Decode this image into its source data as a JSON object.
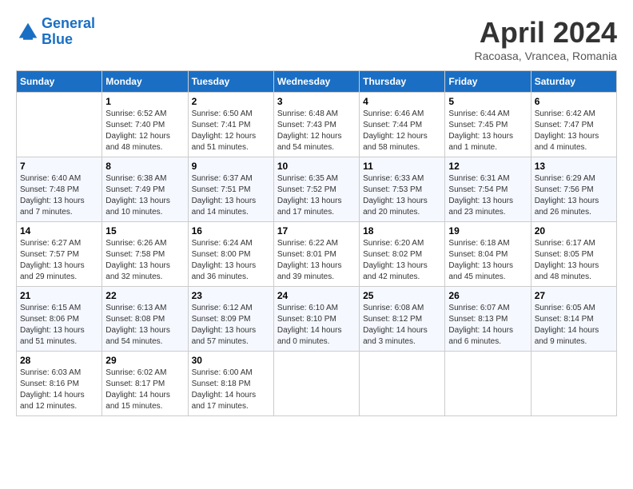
{
  "header": {
    "logo_line1": "General",
    "logo_line2": "Blue",
    "title": "April 2024",
    "subtitle": "Racoasa, Vrancea, Romania"
  },
  "calendar": {
    "headers": [
      "Sunday",
      "Monday",
      "Tuesday",
      "Wednesday",
      "Thursday",
      "Friday",
      "Saturday"
    ],
    "weeks": [
      [
        {
          "day": "",
          "info": ""
        },
        {
          "day": "1",
          "info": "Sunrise: 6:52 AM\nSunset: 7:40 PM\nDaylight: 12 hours\nand 48 minutes."
        },
        {
          "day": "2",
          "info": "Sunrise: 6:50 AM\nSunset: 7:41 PM\nDaylight: 12 hours\nand 51 minutes."
        },
        {
          "day": "3",
          "info": "Sunrise: 6:48 AM\nSunset: 7:43 PM\nDaylight: 12 hours\nand 54 minutes."
        },
        {
          "day": "4",
          "info": "Sunrise: 6:46 AM\nSunset: 7:44 PM\nDaylight: 12 hours\nand 58 minutes."
        },
        {
          "day": "5",
          "info": "Sunrise: 6:44 AM\nSunset: 7:45 PM\nDaylight: 13 hours\nand 1 minute."
        },
        {
          "day": "6",
          "info": "Sunrise: 6:42 AM\nSunset: 7:47 PM\nDaylight: 13 hours\nand 4 minutes."
        }
      ],
      [
        {
          "day": "7",
          "info": "Sunrise: 6:40 AM\nSunset: 7:48 PM\nDaylight: 13 hours\nand 7 minutes."
        },
        {
          "day": "8",
          "info": "Sunrise: 6:38 AM\nSunset: 7:49 PM\nDaylight: 13 hours\nand 10 minutes."
        },
        {
          "day": "9",
          "info": "Sunrise: 6:37 AM\nSunset: 7:51 PM\nDaylight: 13 hours\nand 14 minutes."
        },
        {
          "day": "10",
          "info": "Sunrise: 6:35 AM\nSunset: 7:52 PM\nDaylight: 13 hours\nand 17 minutes."
        },
        {
          "day": "11",
          "info": "Sunrise: 6:33 AM\nSunset: 7:53 PM\nDaylight: 13 hours\nand 20 minutes."
        },
        {
          "day": "12",
          "info": "Sunrise: 6:31 AM\nSunset: 7:54 PM\nDaylight: 13 hours\nand 23 minutes."
        },
        {
          "day": "13",
          "info": "Sunrise: 6:29 AM\nSunset: 7:56 PM\nDaylight: 13 hours\nand 26 minutes."
        }
      ],
      [
        {
          "day": "14",
          "info": "Sunrise: 6:27 AM\nSunset: 7:57 PM\nDaylight: 13 hours\nand 29 minutes."
        },
        {
          "day": "15",
          "info": "Sunrise: 6:26 AM\nSunset: 7:58 PM\nDaylight: 13 hours\nand 32 minutes."
        },
        {
          "day": "16",
          "info": "Sunrise: 6:24 AM\nSunset: 8:00 PM\nDaylight: 13 hours\nand 36 minutes."
        },
        {
          "day": "17",
          "info": "Sunrise: 6:22 AM\nSunset: 8:01 PM\nDaylight: 13 hours\nand 39 minutes."
        },
        {
          "day": "18",
          "info": "Sunrise: 6:20 AM\nSunset: 8:02 PM\nDaylight: 13 hours\nand 42 minutes."
        },
        {
          "day": "19",
          "info": "Sunrise: 6:18 AM\nSunset: 8:04 PM\nDaylight: 13 hours\nand 45 minutes."
        },
        {
          "day": "20",
          "info": "Sunrise: 6:17 AM\nSunset: 8:05 PM\nDaylight: 13 hours\nand 48 minutes."
        }
      ],
      [
        {
          "day": "21",
          "info": "Sunrise: 6:15 AM\nSunset: 8:06 PM\nDaylight: 13 hours\nand 51 minutes."
        },
        {
          "day": "22",
          "info": "Sunrise: 6:13 AM\nSunset: 8:08 PM\nDaylight: 13 hours\nand 54 minutes."
        },
        {
          "day": "23",
          "info": "Sunrise: 6:12 AM\nSunset: 8:09 PM\nDaylight: 13 hours\nand 57 minutes."
        },
        {
          "day": "24",
          "info": "Sunrise: 6:10 AM\nSunset: 8:10 PM\nDaylight: 14 hours\nand 0 minutes."
        },
        {
          "day": "25",
          "info": "Sunrise: 6:08 AM\nSunset: 8:12 PM\nDaylight: 14 hours\nand 3 minutes."
        },
        {
          "day": "26",
          "info": "Sunrise: 6:07 AM\nSunset: 8:13 PM\nDaylight: 14 hours\nand 6 minutes."
        },
        {
          "day": "27",
          "info": "Sunrise: 6:05 AM\nSunset: 8:14 PM\nDaylight: 14 hours\nand 9 minutes."
        }
      ],
      [
        {
          "day": "28",
          "info": "Sunrise: 6:03 AM\nSunset: 8:16 PM\nDaylight: 14 hours\nand 12 minutes."
        },
        {
          "day": "29",
          "info": "Sunrise: 6:02 AM\nSunset: 8:17 PM\nDaylight: 14 hours\nand 15 minutes."
        },
        {
          "day": "30",
          "info": "Sunrise: 6:00 AM\nSunset: 8:18 PM\nDaylight: 14 hours\nand 17 minutes."
        },
        {
          "day": "",
          "info": ""
        },
        {
          "day": "",
          "info": ""
        },
        {
          "day": "",
          "info": ""
        },
        {
          "day": "",
          "info": ""
        }
      ]
    ]
  }
}
